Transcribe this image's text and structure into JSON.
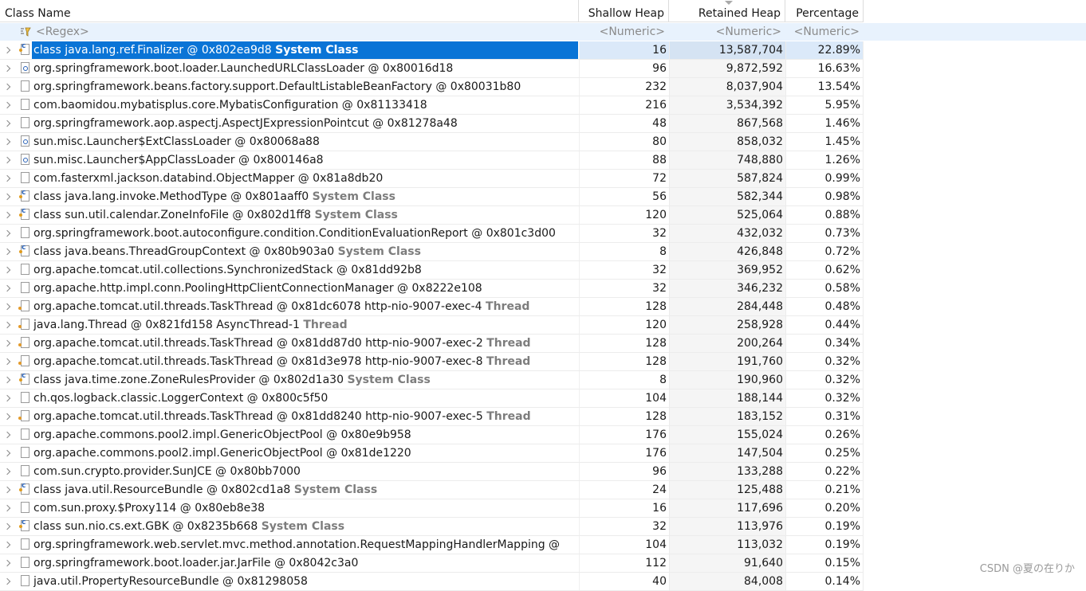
{
  "columns": {
    "class_name": "Class Name",
    "shallow_heap": "Shallow Heap",
    "retained_heap": "Retained Heap",
    "percentage": "Percentage"
  },
  "filter": {
    "regex": "<Regex>",
    "numeric": "<Numeric>"
  },
  "rows": [
    {
      "name": "class java.lang.ref.Finalizer @ 0x802ea9d8",
      "suffix": "System Class",
      "icon": "class-object-icon",
      "shallow": "16",
      "retained": "13,587,704",
      "pct": "22.89%"
    },
    {
      "name": "org.springframework.boot.loader.LaunchedURLClassLoader @ 0x80016d18",
      "suffix": "",
      "icon": "classloader-icon",
      "shallow": "96",
      "retained": "9,872,592",
      "pct": "16.63%"
    },
    {
      "name": "org.springframework.beans.factory.support.DefaultListableBeanFactory @ 0x80031b80",
      "suffix": "",
      "icon": "object-icon",
      "shallow": "232",
      "retained": "8,037,904",
      "pct": "13.54%"
    },
    {
      "name": "com.baomidou.mybatisplus.core.MybatisConfiguration @ 0x81133418",
      "suffix": "",
      "icon": "object-icon",
      "shallow": "216",
      "retained": "3,534,392",
      "pct": "5.95%"
    },
    {
      "name": "org.springframework.aop.aspectj.AspectJExpressionPointcut @ 0x81278a48",
      "suffix": "",
      "icon": "object-icon",
      "shallow": "48",
      "retained": "867,568",
      "pct": "1.46%"
    },
    {
      "name": "sun.misc.Launcher$ExtClassLoader @ 0x80068a88",
      "suffix": "",
      "icon": "classloader-icon",
      "shallow": "80",
      "retained": "858,032",
      "pct": "1.45%"
    },
    {
      "name": "sun.misc.Launcher$AppClassLoader @ 0x800146a8",
      "suffix": "",
      "icon": "classloader-icon",
      "shallow": "88",
      "retained": "748,880",
      "pct": "1.26%"
    },
    {
      "name": "com.fasterxml.jackson.databind.ObjectMapper @ 0x81a8db20",
      "suffix": "",
      "icon": "object-icon",
      "shallow": "72",
      "retained": "587,824",
      "pct": "0.99%"
    },
    {
      "name": "class java.lang.invoke.MethodType @ 0x801aaff0",
      "suffix": "System Class",
      "icon": "class-object-icon",
      "shallow": "56",
      "retained": "582,344",
      "pct": "0.98%"
    },
    {
      "name": "class sun.util.calendar.ZoneInfoFile @ 0x802d1ff8",
      "suffix": "System Class",
      "icon": "class-object-icon",
      "shallow": "120",
      "retained": "525,064",
      "pct": "0.88%"
    },
    {
      "name": "org.springframework.boot.autoconfigure.condition.ConditionEvaluationReport @ 0x801c3d00",
      "suffix": "",
      "icon": "object-icon",
      "shallow": "32",
      "retained": "432,032",
      "pct": "0.73%"
    },
    {
      "name": "class java.beans.ThreadGroupContext @ 0x80b903a0",
      "suffix": "System Class",
      "icon": "class-object-icon",
      "shallow": "8",
      "retained": "426,848",
      "pct": "0.72%"
    },
    {
      "name": "org.apache.tomcat.util.collections.SynchronizedStack @ 0x81dd92b8",
      "suffix": "",
      "icon": "object-icon",
      "shallow": "32",
      "retained": "369,952",
      "pct": "0.62%"
    },
    {
      "name": "org.apache.http.impl.conn.PoolingHttpClientConnectionManager @ 0x8222e108",
      "suffix": "",
      "icon": "object-icon",
      "shallow": "32",
      "retained": "346,232",
      "pct": "0.58%"
    },
    {
      "name": "org.apache.tomcat.util.threads.TaskThread @ 0x81dc6078  http-nio-9007-exec-4",
      "suffix": "Thread",
      "icon": "thread-icon",
      "shallow": "128",
      "retained": "284,448",
      "pct": "0.48%"
    },
    {
      "name": "java.lang.Thread @ 0x821fd158  AsyncThread-1",
      "suffix": "Thread",
      "icon": "thread-icon",
      "shallow": "120",
      "retained": "258,928",
      "pct": "0.44%"
    },
    {
      "name": "org.apache.tomcat.util.threads.TaskThread @ 0x81dd87d0  http-nio-9007-exec-2",
      "suffix": "Thread",
      "icon": "thread-icon",
      "shallow": "128",
      "retained": "200,264",
      "pct": "0.34%"
    },
    {
      "name": "org.apache.tomcat.util.threads.TaskThread @ 0x81d3e978  http-nio-9007-exec-8",
      "suffix": "Thread",
      "icon": "thread-icon",
      "shallow": "128",
      "retained": "191,760",
      "pct": "0.32%"
    },
    {
      "name": "class java.time.zone.ZoneRulesProvider @ 0x802d1a30",
      "suffix": "System Class",
      "icon": "class-object-icon",
      "shallow": "8",
      "retained": "190,960",
      "pct": "0.32%"
    },
    {
      "name": "ch.qos.logback.classic.LoggerContext @ 0x800c5f50",
      "suffix": "",
      "icon": "object-icon",
      "shallow": "104",
      "retained": "188,144",
      "pct": "0.32%"
    },
    {
      "name": "org.apache.tomcat.util.threads.TaskThread @ 0x81dd8240  http-nio-9007-exec-5",
      "suffix": "Thread",
      "icon": "thread-icon",
      "shallow": "128",
      "retained": "183,152",
      "pct": "0.31%"
    },
    {
      "name": "org.apache.commons.pool2.impl.GenericObjectPool @ 0x80e9b958",
      "suffix": "",
      "icon": "object-icon",
      "shallow": "176",
      "retained": "155,024",
      "pct": "0.26%"
    },
    {
      "name": "org.apache.commons.pool2.impl.GenericObjectPool @ 0x81de1220",
      "suffix": "",
      "icon": "object-icon",
      "shallow": "176",
      "retained": "147,504",
      "pct": "0.25%"
    },
    {
      "name": "com.sun.crypto.provider.SunJCE @ 0x80bb7000",
      "suffix": "",
      "icon": "object-icon",
      "shallow": "96",
      "retained": "133,288",
      "pct": "0.22%"
    },
    {
      "name": "class java.util.ResourceBundle @ 0x802cd1a8",
      "suffix": "System Class",
      "icon": "class-object-icon",
      "shallow": "24",
      "retained": "125,488",
      "pct": "0.21%"
    },
    {
      "name": "com.sun.proxy.$Proxy114 @ 0x80eb8e38",
      "suffix": "",
      "icon": "object-icon",
      "shallow": "16",
      "retained": "117,696",
      "pct": "0.20%"
    },
    {
      "name": "class sun.nio.cs.ext.GBK @ 0x8235b668",
      "suffix": "System Class",
      "icon": "class-object-icon",
      "shallow": "32",
      "retained": "113,976",
      "pct": "0.19%"
    },
    {
      "name": "org.springframework.web.servlet.mvc.method.annotation.RequestMappingHandlerMapping @",
      "suffix": "",
      "icon": "object-icon",
      "shallow": "104",
      "retained": "113,032",
      "pct": "0.19%"
    },
    {
      "name": "org.springframework.boot.loader.jar.JarFile @ 0x8042c3a0",
      "suffix": "",
      "icon": "object-icon",
      "shallow": "112",
      "retained": "91,640",
      "pct": "0.15%"
    },
    {
      "name": "java.util.PropertyResourceBundle @ 0x81298058",
      "suffix": "",
      "icon": "object-icon",
      "shallow": "40",
      "retained": "84,008",
      "pct": "0.14%"
    }
  ],
  "watermark": "CSDN @夏の在りか"
}
